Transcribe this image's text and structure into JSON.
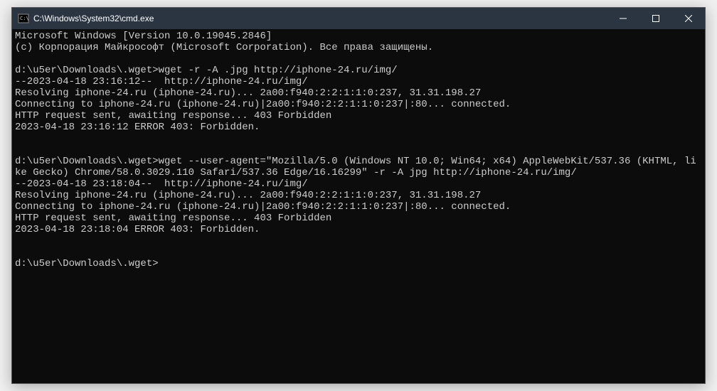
{
  "window": {
    "title": "C:\\Windows\\System32\\cmd.exe"
  },
  "terminal": {
    "lines": [
      "Microsoft Windows [Version 10.0.19045.2846]",
      "(c) Корпорация Майкрософт (Microsoft Corporation). Все права защищены.",
      "",
      "d:\\u5er\\Downloads\\.wget>wget -r -A .jpg http://iphone-24.ru/img/",
      "--2023-04-18 23:16:12--  http://iphone-24.ru/img/",
      "Resolving iphone-24.ru (iphone-24.ru)... 2a00:f940:2:2:1:1:0:237, 31.31.198.27",
      "Connecting to iphone-24.ru (iphone-24.ru)|2a00:f940:2:2:1:1:0:237|:80... connected.",
      "HTTP request sent, awaiting response... 403 Forbidden",
      "2023-04-18 23:16:12 ERROR 403: Forbidden.",
      "",
      "",
      "d:\\u5er\\Downloads\\.wget>wget --user-agent=\"Mozilla/5.0 (Windows NT 10.0; Win64; x64) AppleWebKit/537.36 (KHTML, like Gecko) Chrome/58.0.3029.110 Safari/537.36 Edge/16.16299\" -r -A jpg http://iphone-24.ru/img/",
      "--2023-04-18 23:18:04--  http://iphone-24.ru/img/",
      "Resolving iphone-24.ru (iphone-24.ru)... 2a00:f940:2:2:1:1:0:237, 31.31.198.27",
      "Connecting to iphone-24.ru (iphone-24.ru)|2a00:f940:2:2:1:1:0:237|:80... connected.",
      "HTTP request sent, awaiting response... 403 Forbidden",
      "2023-04-18 23:18:04 ERROR 403: Forbidden.",
      "",
      "",
      "d:\\u5er\\Downloads\\.wget>"
    ]
  }
}
